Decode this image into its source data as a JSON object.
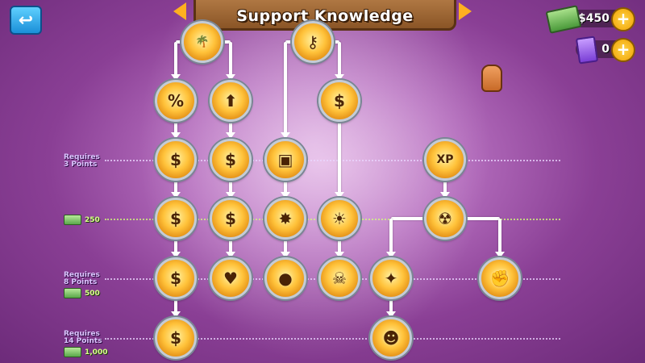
{
  "header": {
    "title": "Support Knowledge",
    "back_icon": "back-arrow-icon",
    "prev_icon": "chevron-left-icon",
    "next_icon": "chevron-right-icon"
  },
  "currency": {
    "cash": "$450",
    "knowledge_points": "0"
  },
  "rows": [
    {
      "requires_line1": "Requires",
      "requires_line2": "3 Points"
    },
    {
      "cost": "250"
    },
    {
      "requires_line1": "Requires",
      "requires_line2": "8 Points",
      "cost": "500"
    },
    {
      "requires_line1": "Requires",
      "requires_line2": "14 Points",
      "cost": "1,000"
    }
  ],
  "nodes": [
    {
      "id": "n-root-a",
      "icon": "palm-tree-icon",
      "glyph": "🌴"
    },
    {
      "id": "n-root-b",
      "icon": "monkey-key-icon",
      "glyph": "⚷"
    },
    {
      "id": "n-r1-a",
      "icon": "percent-discount-icon",
      "glyph": "%"
    },
    {
      "id": "n-r1-b",
      "icon": "banana-upgrade-icon",
      "glyph": "⬆"
    },
    {
      "id": "n-r1-d",
      "icon": "coin-income-icon",
      "glyph": "$"
    },
    {
      "id": "n-r2-a",
      "icon": "coin-bank-icon",
      "glyph": "$"
    },
    {
      "id": "n-r2-b",
      "icon": "coin-farm-icon",
      "glyph": "$"
    },
    {
      "id": "n-r2-c",
      "icon": "village-tower-icon",
      "glyph": "▣"
    },
    {
      "id": "n-r2-f",
      "icon": "xp-bonus-icon",
      "glyph": "XP"
    },
    {
      "id": "n-r3-a",
      "icon": "coin-crate-icon",
      "glyph": "$"
    },
    {
      "id": "n-r3-b",
      "icon": "coin-leaf-icon",
      "glyph": "$"
    },
    {
      "id": "n-r3-c",
      "icon": "explosion-icon",
      "glyph": "✸"
    },
    {
      "id": "n-r3-d",
      "icon": "sun-burst-icon",
      "glyph": "☀"
    },
    {
      "id": "n-r3-f",
      "icon": "radiation-icon",
      "glyph": "☢"
    },
    {
      "id": "n-r4-a",
      "icon": "coin-tree-icon",
      "glyph": "$"
    },
    {
      "id": "n-r4-b",
      "icon": "heart-coin-icon",
      "glyph": "♥"
    },
    {
      "id": "n-r4-c",
      "icon": "bomb-icon",
      "glyph": "●"
    },
    {
      "id": "n-r4-d",
      "icon": "skull-coin-icon",
      "glyph": "☠"
    },
    {
      "id": "n-r4-e",
      "icon": "shatter-darts-icon",
      "glyph": "✦"
    },
    {
      "id": "n-r4-g",
      "icon": "fist-power-icon",
      "glyph": "✊"
    },
    {
      "id": "n-r5-a",
      "icon": "coin-cart-icon",
      "glyph": "$"
    },
    {
      "id": "n-r5-e",
      "icon": "alien-face-icon",
      "glyph": "☻"
    }
  ],
  "colors": {
    "background": "#8a3f95",
    "node_gold": "#ffc23a",
    "connector": "#ffffff",
    "cost_text": "#d8ff8a",
    "requires_text": "#dcc6ff"
  }
}
